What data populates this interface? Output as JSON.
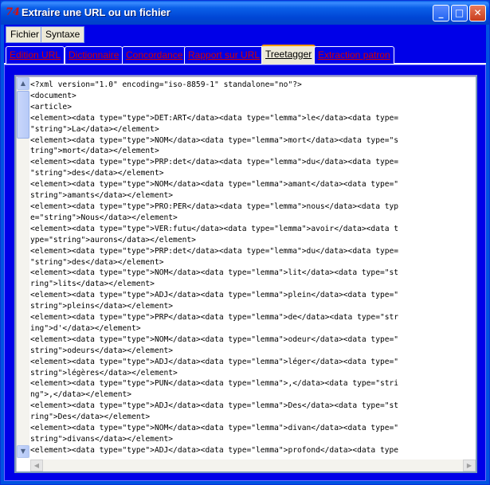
{
  "window": {
    "icon_glyph": "74",
    "title": "Extraire une URL ou un fichier",
    "controls": {
      "minimize": "_",
      "maximize": "□",
      "close": "✕"
    }
  },
  "menu": {
    "items": [
      {
        "label": "Fichier"
      },
      {
        "label": "Syntaxe"
      }
    ]
  },
  "tabs": {
    "items": [
      {
        "label": "Edition URL"
      },
      {
        "label": "Dictionnaire"
      },
      {
        "label": "Concordance"
      },
      {
        "label": "Rapport sur URL"
      },
      {
        "label": "Treetagger"
      },
      {
        "label": "Extraction patron"
      }
    ],
    "active": "Treetagger"
  },
  "editor": {
    "lines": [
      "<?xml version=\"1.0\" encoding=\"iso-8859-1\" standalone=\"no\"?>",
      "<document>",
      "<article>",
      "<element><data type=\"type\">DET:ART</data><data type=\"lemma\">le</data><data type=",
      "\"string\">La</data></element>",
      "<element><data type=\"type\">NOM</data><data type=\"lemma\">mort</data><data type=\"s",
      "tring\">mort</data></element>",
      "<element><data type=\"type\">PRP:det</data><data type=\"lemma\">du</data><data type=",
      "\"string\">des</data></element>",
      "<element><data type=\"type\">NOM</data><data type=\"lemma\">amant</data><data type=\"",
      "string\">amants</data></element>",
      "<element><data type=\"type\">PRO:PER</data><data type=\"lemma\">nous</data><data typ",
      "e=\"string\">Nous</data></element>",
      "<element><data type=\"type\">VER:futu</data><data type=\"lemma\">avoir</data><data t",
      "ype=\"string\">aurons</data></element>",
      "<element><data type=\"type\">PRP:det</data><data type=\"lemma\">du</data><data type=",
      "\"string\">des</data></element>",
      "<element><data type=\"type\">NOM</data><data type=\"lemma\">lit</data><data type=\"st",
      "ring\">lits</data></element>",
      "<element><data type=\"type\">ADJ</data><data type=\"lemma\">plein</data><data type=\"",
      "string\">pleins</data></element>",
      "<element><data type=\"type\">PRP</data><data type=\"lemma\">de</data><data type=\"str",
      "ing\">d'</data></element>",
      "<element><data type=\"type\">NOM</data><data type=\"lemma\">odeur</data><data type=\"",
      "string\">odeurs</data></element>",
      "<element><data type=\"type\">ADJ</data><data type=\"lemma\">léger</data><data type=\"",
      "string\">légères</data></element>",
      "<element><data type=\"type\">PUN</data><data type=\"lemma\">,</data><data type=\"stri",
      "ng\">,</data></element>",
      "<element><data type=\"type\">ADJ</data><data type=\"lemma\">Des</data><data type=\"st",
      "ring\">Des</data></element>",
      "<element><data type=\"type\">NOM</data><data type=\"lemma\">divan</data><data type=\"",
      "string\">divans</data></element>",
      "<element><data type=\"type\">ADJ</data><data type=\"lemma\">profond</data><data type"
    ]
  },
  "scroll": {
    "up": "▲",
    "down": "▼",
    "left": "◀",
    "right": "▶"
  }
}
